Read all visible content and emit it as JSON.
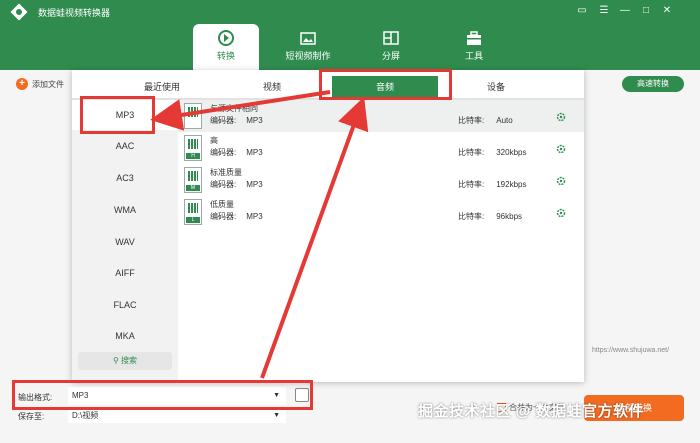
{
  "app": {
    "title": "数据蛙视频转换器"
  },
  "tabs": [
    {
      "label": "转换"
    },
    {
      "label": "短视频制作"
    },
    {
      "label": "分屏"
    },
    {
      "label": "工具"
    }
  ],
  "main": {
    "add_file": "添加文件",
    "fast_convert": "高速转换",
    "website": "https://www.shujuwa.net/",
    "merge_label": "合并为一个文件",
    "convert_all": "全部转换"
  },
  "popup": {
    "tabs": [
      "最近使用",
      "视频",
      "音频",
      "设备"
    ],
    "active_tab": "音频",
    "formats": [
      "MP3",
      "AAC",
      "AC3",
      "WMA",
      "WAV",
      "AIFF",
      "FLAC",
      "MKA"
    ],
    "search": "搜索",
    "presets": [
      {
        "name": "与源文件相同",
        "codec_label": "编码器:",
        "codec": "MP3",
        "bitrate_label": "比特率:",
        "bitrate": "Auto",
        "badge": ""
      },
      {
        "name": "高",
        "codec_label": "编码器:",
        "codec": "MP3",
        "bitrate_label": "比特率:",
        "bitrate": "320kbps",
        "badge": "H"
      },
      {
        "name": "标准质量",
        "codec_label": "编码器:",
        "codec": "MP3",
        "bitrate_label": "比特率:",
        "bitrate": "192kbps",
        "badge": "M"
      },
      {
        "name": "低质量",
        "codec_label": "编码器:",
        "codec": "MP3",
        "bitrate_label": "比特率:",
        "bitrate": "96kbps",
        "badge": "L"
      }
    ]
  },
  "output": {
    "format_label": "输出格式:",
    "format_value": "MP3",
    "save_label": "保存至:",
    "save_value": "D:\\视频"
  },
  "watermark": "掘金技术社区 @ 数据蛙官方软件",
  "colors": {
    "brand": "#2f8c4e",
    "accent": "#f36b21",
    "annotation": "#e53935"
  }
}
